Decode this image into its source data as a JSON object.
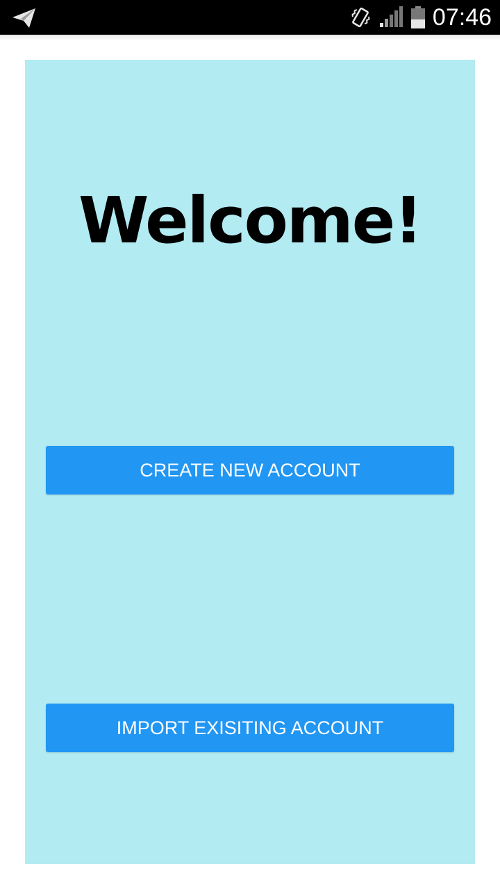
{
  "status_bar": {
    "time": "07:46",
    "icons": [
      "send-icon",
      "vibrate-icon",
      "signal-icon",
      "battery-icon"
    ],
    "background": "#000000"
  },
  "main": {
    "title": "Welcome!",
    "background": "#b2ebf2",
    "create_button_label": "CREATE NEW ACCOUNT",
    "import_button_label": "IMPORT EXISITING ACCOUNT",
    "button_color": "#2196f3"
  }
}
